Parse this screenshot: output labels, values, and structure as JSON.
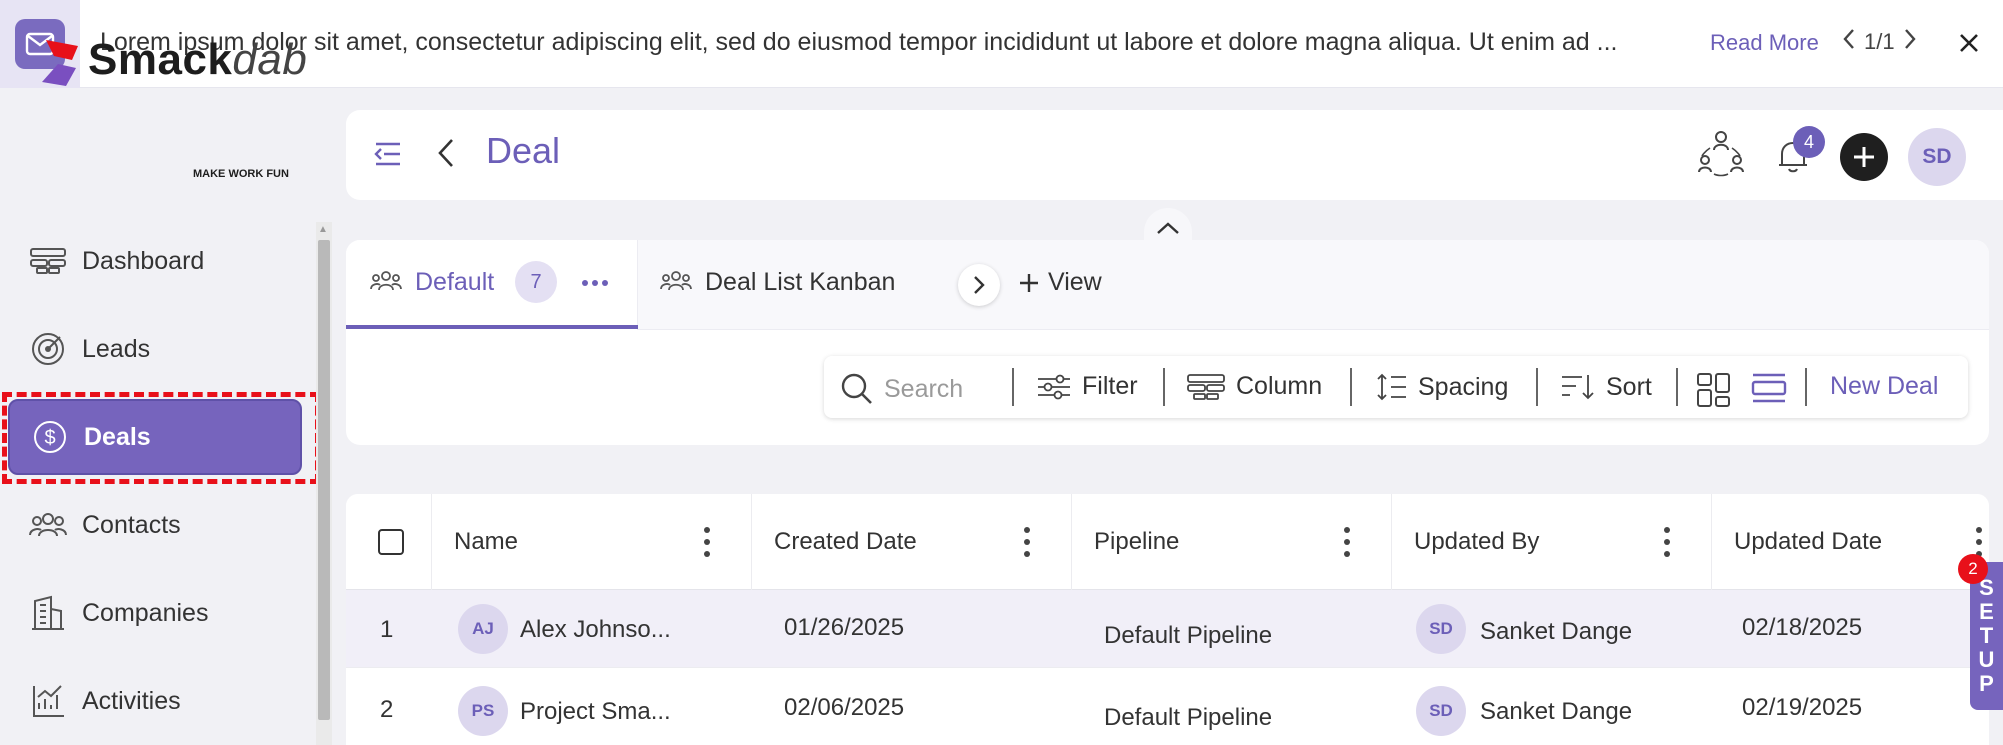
{
  "banner": {
    "message": "Lorem ipsum dolor sit amet, consectetur adipiscing elit, sed do eiusmod tempor incididunt ut labore et dolore magna aliqua. Ut enim ad ...",
    "read_more": "Read More",
    "pager": "1/1"
  },
  "brand": {
    "name_primary": "Smack",
    "name_secondary": "dab",
    "tagline": "MAKE WORK FUN"
  },
  "sidebar": {
    "items": [
      {
        "label": "Dashboard",
        "icon": "dashboard-icon"
      },
      {
        "label": "Leads",
        "icon": "target-icon"
      },
      {
        "label": "Deals",
        "icon": "dollar-circle-icon",
        "active": true
      },
      {
        "label": "Contacts",
        "icon": "people-icon"
      },
      {
        "label": "Companies",
        "icon": "building-icon"
      },
      {
        "label": "Activities",
        "icon": "activity-chart-icon"
      }
    ]
  },
  "header": {
    "title": "Deal",
    "notification_count": "4",
    "user_initials": "SD"
  },
  "tabs": [
    {
      "label": "Default",
      "count": "7",
      "active": true
    },
    {
      "label": "Deal List Kanban"
    }
  ],
  "add_view_label": "View",
  "toolbar": {
    "search_placeholder": "Search",
    "filter": "Filter",
    "column": "Column",
    "spacing": "Spacing",
    "sort": "Sort",
    "new_deal": "New Deal"
  },
  "table": {
    "columns": [
      "Name",
      "Created Date",
      "Pipeline",
      "Updated By",
      "Updated Date"
    ],
    "rows": [
      {
        "index": "1",
        "initials": "AJ",
        "name": "Alex Johnso...",
        "created": "01/26/2025",
        "pipeline": "Default Pipeline",
        "updated_by_initials": "SD",
        "updated_by": "Sanket Dange",
        "updated": "02/18/2025"
      },
      {
        "index": "2",
        "initials": "PS",
        "name": "Project Sma...",
        "created": "02/06/2025",
        "pipeline": "Default Pipeline",
        "updated_by_initials": "SD",
        "updated_by": "Sanket Dange",
        "updated": "02/19/2025"
      }
    ]
  },
  "setup": {
    "letters": [
      "S",
      "E",
      "T",
      "U",
      "P"
    ],
    "badge": "2"
  },
  "colors": {
    "accent": "#6c5fb8",
    "active_nav": "#7664bd",
    "highlight": "#e8101a"
  }
}
